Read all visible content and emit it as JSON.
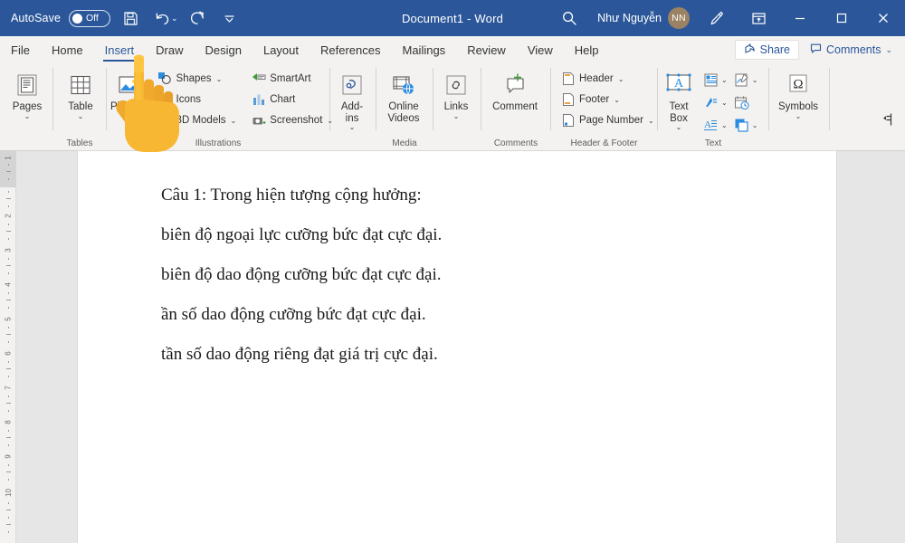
{
  "titlebar": {
    "autosave_label": "AutoSave",
    "autosave_state": "Off",
    "save_icon": "save-icon",
    "undo_icon": "undo-icon",
    "redo_icon": "redo-icon",
    "customize_qat_icon": "customize-quick-access-toolbar-icon",
    "document_title": "Document1  -  Word",
    "search_icon": "search-icon",
    "user_name": "Như Nguyễn",
    "user_initials": "NN",
    "ink_icon": "pen-ink-icon",
    "ribbon_display_icon": "ribbon-display-options-icon",
    "minimize_icon": "minimize-icon",
    "maximize_icon": "maximize-icon",
    "close_icon": "close-icon",
    "bg_color": "#2b579a",
    "avatar_color": "#9b8264"
  },
  "tabs": [
    {
      "label": "File",
      "active": false
    },
    {
      "label": "Home",
      "active": false
    },
    {
      "label": "Insert",
      "active": true
    },
    {
      "label": "Draw",
      "active": false
    },
    {
      "label": "Design",
      "active": false
    },
    {
      "label": "Layout",
      "active": false
    },
    {
      "label": "References",
      "active": false
    },
    {
      "label": "Mailings",
      "active": false
    },
    {
      "label": "Review",
      "active": false
    },
    {
      "label": "View",
      "active": false
    },
    {
      "label": "Help",
      "active": false
    }
  ],
  "tabstrip_right": {
    "share_label": "Share",
    "share_icon": "share-icon",
    "comments_label": "Comments",
    "comments_icon": "comment-bubble-icon",
    "comments_chevron": "chevron-down-icon",
    "accent_color": "#2b579a"
  },
  "ribbon": {
    "groups": [
      {
        "name": "pages",
        "label": "",
        "big_buttons": [
          {
            "label": "Pages",
            "icon": "pages-icon",
            "chevron": "⌄"
          }
        ]
      },
      {
        "name": "tables",
        "label": "Tables",
        "big_buttons": [
          {
            "label": "Table",
            "icon": "table-icon",
            "chevron": "⌄"
          }
        ]
      },
      {
        "name": "illustrations",
        "label": "Illustrations",
        "big_buttons": [
          {
            "label": "Pictures",
            "icon": "pictures-icon",
            "chevron": "⌄"
          }
        ],
        "small_buttons": [
          {
            "label": "Shapes",
            "icon": "shapes-icon",
            "chevron": "⌄"
          },
          {
            "label": "Icons",
            "icon": "icons-icon",
            "chevron": ""
          },
          {
            "label": "3D Models",
            "icon": "3d-models-icon",
            "chevron": "⌄"
          },
          {
            "label": "SmartArt",
            "icon": "smartart-icon",
            "chevron": ""
          },
          {
            "label": "Chart",
            "icon": "chart-icon",
            "chevron": ""
          },
          {
            "label": "Screenshot",
            "icon": "screenshot-icon",
            "chevron": "⌄"
          }
        ]
      },
      {
        "name": "add-ins",
        "label": "",
        "big_buttons": [
          {
            "label": "Add-\nins",
            "icon": "add-ins-icon",
            "chevron": "⌄"
          }
        ]
      },
      {
        "name": "media",
        "label": "Media",
        "big_buttons": [
          {
            "label": "Online\nVideos",
            "icon": "online-videos-icon",
            "chevron": ""
          }
        ]
      },
      {
        "name": "links",
        "label": "",
        "big_buttons": [
          {
            "label": "Links",
            "icon": "links-icon",
            "chevron": "⌄"
          }
        ]
      },
      {
        "name": "comments",
        "label": "Comments",
        "big_buttons": [
          {
            "label": "Comment",
            "icon": "new-comment-icon",
            "chevron": ""
          }
        ]
      },
      {
        "name": "header-footer",
        "label": "Header & Footer",
        "small_buttons": [
          {
            "label": "Header",
            "icon": "header-icon",
            "chevron": "⌄"
          },
          {
            "label": "Footer",
            "icon": "footer-icon",
            "chevron": "⌄"
          },
          {
            "label": "Page Number",
            "icon": "page-number-icon",
            "chevron": "⌄"
          }
        ]
      },
      {
        "name": "text",
        "label": "Text",
        "big_buttons": [
          {
            "label": "Text\nBox",
            "icon": "text-box-icon",
            "chevron": "⌄"
          }
        ],
        "grid_icons": [
          {
            "icon": "quick-parts-icon",
            "chevron": "⌄"
          },
          {
            "icon": "wordart-icon",
            "chevron": "⌄"
          },
          {
            "icon": "drop-cap-icon",
            "chevron": "⌄"
          },
          {
            "icon": "signature-line-icon",
            "chevron": "⌄"
          },
          {
            "icon": "date-time-icon",
            "chevron": ""
          },
          {
            "icon": "object-icon",
            "chevron": "⌄"
          }
        ]
      },
      {
        "name": "symbols",
        "label": "",
        "big_buttons": [
          {
            "label": "Symbols",
            "icon": "symbols-omega-icon",
            "chevron": "⌄"
          }
        ]
      }
    ],
    "pin_icon": "pin-ribbon-icon"
  },
  "ruler": {
    "name": "vertical-ruler",
    "numbers": [
      1,
      2,
      3,
      4,
      5,
      6,
      7,
      8,
      9,
      10
    ],
    "unit": "cm"
  },
  "document": {
    "lines": [
      "Câu 1: Trong hiện tượng cộng hưởng:",
      "biên độ ngoại lực cưỡng bức đạt cực đại.",
      "biên độ dao động cưỡng bức đạt cực đại.",
      "ần số dao động cưỡng bức đạt cực đại.",
      "tần số dao động riêng đạt giá trị cực đại."
    ]
  },
  "cursor": {
    "name": "pointing-hand-cursor",
    "color": "#f6b93b",
    "points_at": "Pictures"
  }
}
